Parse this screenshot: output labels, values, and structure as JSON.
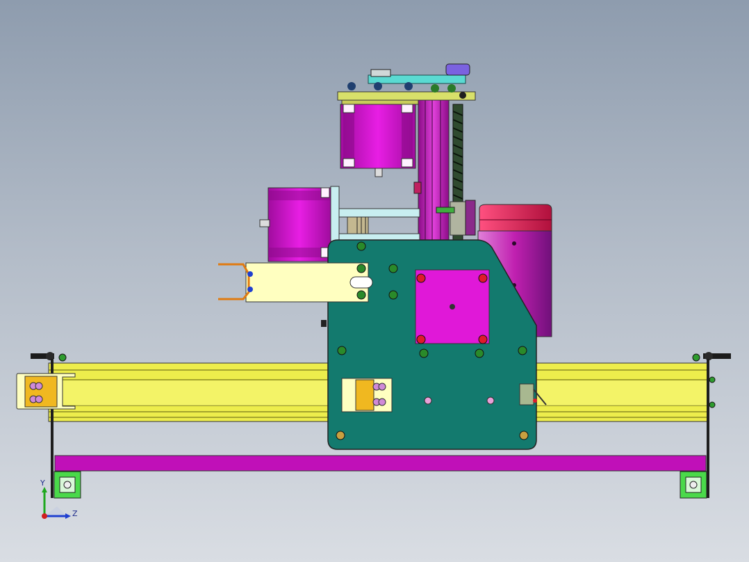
{
  "viewport": {
    "title": "",
    "background_top": "#8e9cae",
    "background_bottom": "#d9dde3"
  },
  "triad": {
    "y_label": "Y",
    "z_label": "Z",
    "y_color": "#1fa81f",
    "z_color": "#1f3fd0",
    "x_color": "#d01f1f"
  },
  "colors": {
    "motor": "#d214cf",
    "frame_rail": "#f0f050",
    "carriage_plate": "#137a6e",
    "spindle": "#c8245a",
    "bracket": "#ffffc0",
    "mount": "#f0c030",
    "profile_end": "#3adb3a",
    "base_bar": "#c010b8",
    "screw": "#2a4a2a"
  },
  "parts": [
    "horizontal-rail",
    "carriage-plate",
    "z-axis-column",
    "z-motor",
    "side-motor",
    "spindle-motor",
    "lead-screw",
    "top-plate",
    "tool-bracket",
    "base-bar",
    "limit-switch"
  ]
}
